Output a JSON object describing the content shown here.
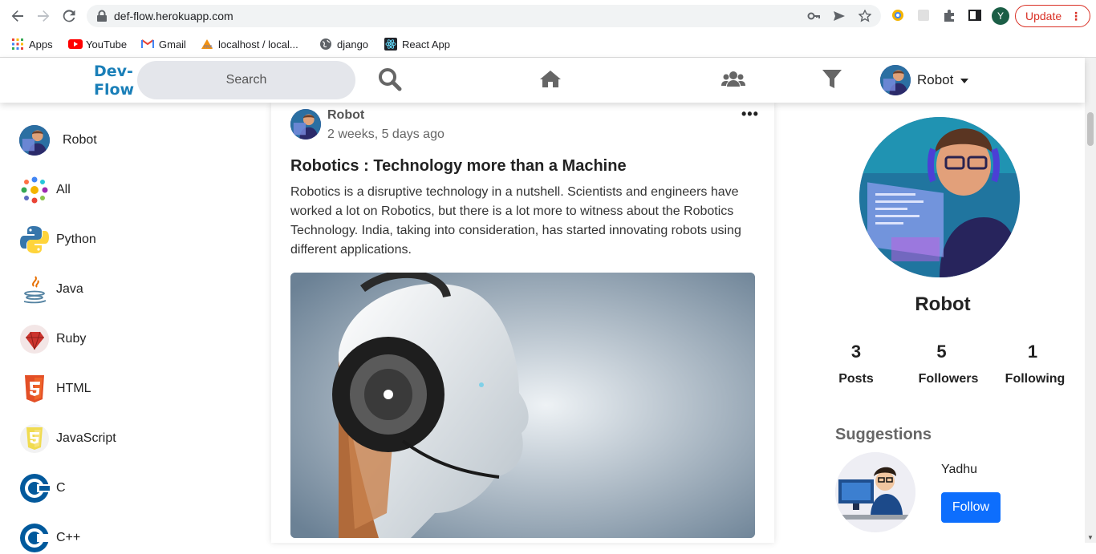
{
  "browser": {
    "url": "def-flow.herokuapp.com",
    "profile_initial": "Y",
    "update_label": "Update",
    "bookmarks": [
      {
        "label": "Apps",
        "icon": "apps-grid-icon"
      },
      {
        "label": "YouTube",
        "icon": "youtube-icon"
      },
      {
        "label": "Gmail",
        "icon": "gmail-icon"
      },
      {
        "label": "localhost / local...",
        "icon": "phpmyadmin-icon"
      },
      {
        "label": "django",
        "icon": "globe-icon"
      },
      {
        "label": "React App",
        "icon": "react-icon"
      }
    ]
  },
  "app": {
    "logo_line1": "Dev-",
    "logo_line2": "Flow",
    "search_placeholder": "Search",
    "user_name": "Robot",
    "colors": {
      "brand": "#1a7fb8",
      "primary_button": "#0d6efd",
      "search_bg": "#e4e6eb"
    }
  },
  "sidebar": {
    "items": [
      {
        "label": "Robot",
        "icon": "robot-avatar-icon"
      },
      {
        "label": "All",
        "icon": "all-languages-icon"
      },
      {
        "label": "Python",
        "icon": "python-icon"
      },
      {
        "label": "Java",
        "icon": "java-icon"
      },
      {
        "label": "Ruby",
        "icon": "ruby-icon"
      },
      {
        "label": "HTML",
        "icon": "html5-icon"
      },
      {
        "label": "JavaScript",
        "icon": "javascript-icon"
      },
      {
        "label": "C",
        "icon": "c-icon"
      },
      {
        "label": "C++",
        "icon": "cpp-icon"
      }
    ]
  },
  "post": {
    "author": "Robot",
    "time": "2 weeks, 5 days ago",
    "more": "•••",
    "title": "Robotics : Technology more than a Machine",
    "body": "Robotics is a disruptive technology in a nutshell. Scientists and engineers have worked a lot on Robotics, but there is a lot more to witness about the Robotics Technology. India, taking into consideration, has started innovating robots using different applications."
  },
  "profile": {
    "name": "Robot",
    "stats": [
      {
        "value": "3",
        "label": "Posts"
      },
      {
        "value": "5",
        "label": "Followers"
      },
      {
        "value": "1",
        "label": "Following"
      }
    ],
    "suggestions_title": "Suggestions",
    "suggestion": {
      "name": "Yadhu",
      "button": "Follow"
    }
  }
}
